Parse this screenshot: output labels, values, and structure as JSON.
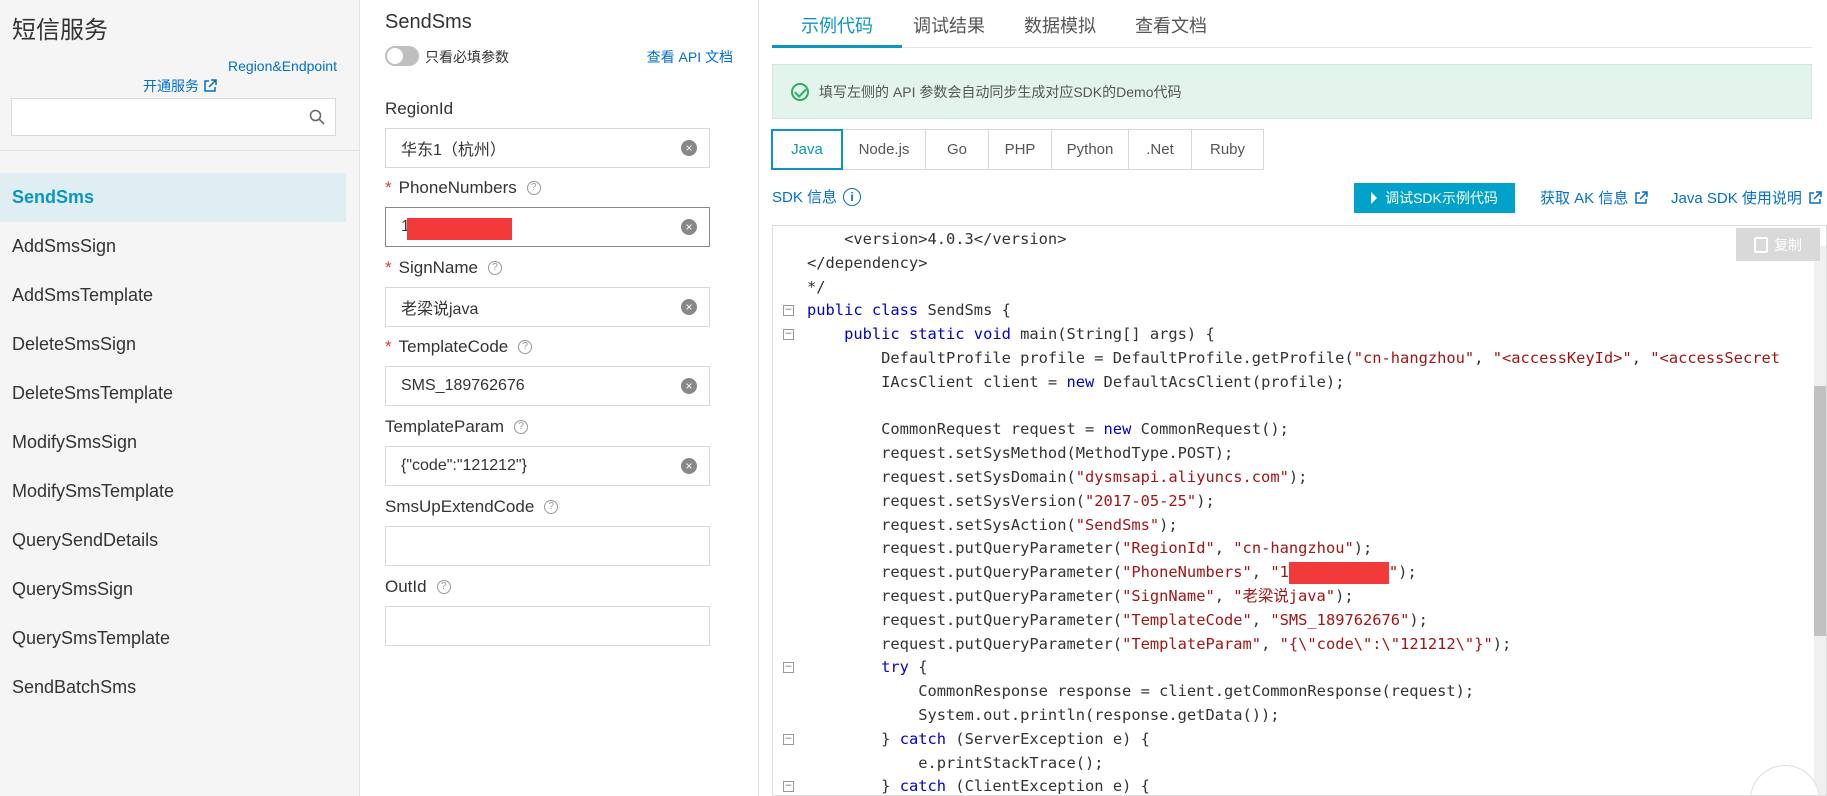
{
  "sidebar": {
    "title": "短信服务",
    "region_link": "Region&Endpoint",
    "open_service": "开通服务",
    "search_placeholder": "",
    "items": [
      "SendSms",
      "AddSmsSign",
      "AddSmsTemplate",
      "DeleteSmsSign",
      "DeleteSmsTemplate",
      "ModifySmsSign",
      "ModifySmsTemplate",
      "QuerySendDetails",
      "QuerySmsSign",
      "QuerySmsTemplate",
      "SendBatchSms"
    ],
    "active_item": "SendSms"
  },
  "params": {
    "title": "SendSms",
    "required_toggle_label": "只看必填参数",
    "api_doc_link": "查看 API 文档",
    "fields": [
      {
        "label": "RegionId",
        "required": false,
        "value": "华东1（杭州）"
      },
      {
        "label": "PhoneNumbers",
        "required": true,
        "value": "1"
      },
      {
        "label": "SignName",
        "required": true,
        "value": "老梁说java"
      },
      {
        "label": "TemplateCode",
        "required": true,
        "value": "SMS_189762676"
      },
      {
        "label": "TemplateParam",
        "required": false,
        "value": "{\"code\":\"121212\"}"
      },
      {
        "label": "SmsUpExtendCode",
        "required": false,
        "value": ""
      },
      {
        "label": "OutId",
        "required": false,
        "value": ""
      }
    ]
  },
  "code_panel": {
    "tabs": [
      "示例代码",
      "调试结果",
      "数据模拟",
      "查看文档"
    ],
    "active_tab": "示例代码",
    "notice": "填写左侧的 API 参数会自动同步生成对应SDK的Demo代码",
    "languages": [
      "Java",
      "Node.js",
      "Go",
      "PHP",
      "Python",
      ".Net",
      "Ruby"
    ],
    "active_language": "Java",
    "sdk_info": "SDK 信息",
    "debug_button": "调试SDK示例代码",
    "ak_link": "获取 AK 信息",
    "java_sdk_link": "Java SDK 使用说明",
    "copy_button": "复制",
    "code_lines": [
      {
        "indent": 1,
        "fold": false,
        "parts": [
          [
            "t",
            "<version>4.0.3</version>"
          ]
        ]
      },
      {
        "indent": 0,
        "fold": false,
        "parts": [
          [
            "t",
            "</dependency>"
          ]
        ]
      },
      {
        "indent": 0,
        "fold": false,
        "parts": [
          [
            "t",
            "*/"
          ]
        ]
      },
      {
        "indent": 0,
        "fold": true,
        "parts": [
          [
            "k",
            "public class"
          ],
          [
            "t",
            " SendSms {"
          ]
        ]
      },
      {
        "indent": 1,
        "fold": true,
        "parts": [
          [
            "k",
            "public static void"
          ],
          [
            "t",
            " main(String[] args) {"
          ]
        ]
      },
      {
        "indent": 2,
        "fold": false,
        "parts": [
          [
            "t",
            "DefaultProfile profile = DefaultProfile.getProfile("
          ],
          [
            "s",
            "\"cn-hangzhou\""
          ],
          [
            "t",
            ", "
          ],
          [
            "s",
            "\"<accessKeyId>\""
          ],
          [
            "t",
            ", "
          ],
          [
            "s",
            "\"<accessSecret"
          ]
        ]
      },
      {
        "indent": 2,
        "fold": false,
        "parts": [
          [
            "t",
            "IAcsClient client = "
          ],
          [
            "k",
            "new"
          ],
          [
            "t",
            " DefaultAcsClient(profile);"
          ]
        ]
      },
      {
        "indent": 0,
        "fold": false,
        "parts": []
      },
      {
        "indent": 2,
        "fold": false,
        "parts": [
          [
            "t",
            "CommonRequest request = "
          ],
          [
            "k",
            "new"
          ],
          [
            "t",
            " CommonRequest();"
          ]
        ]
      },
      {
        "indent": 2,
        "fold": false,
        "parts": [
          [
            "t",
            "request.setSysMethod(MethodType.POST);"
          ]
        ]
      },
      {
        "indent": 2,
        "fold": false,
        "parts": [
          [
            "t",
            "request.setSysDomain("
          ],
          [
            "s",
            "\"dysmsapi.aliyuncs.com\""
          ],
          [
            "t",
            ");"
          ]
        ]
      },
      {
        "indent": 2,
        "fold": false,
        "parts": [
          [
            "t",
            "request.setSysVersion("
          ],
          [
            "s",
            "\"2017-05-25\""
          ],
          [
            "t",
            ");"
          ]
        ]
      },
      {
        "indent": 2,
        "fold": false,
        "parts": [
          [
            "t",
            "request.setSysAction("
          ],
          [
            "s",
            "\"SendSms\""
          ],
          [
            "t",
            ");"
          ]
        ]
      },
      {
        "indent": 2,
        "fold": false,
        "parts": [
          [
            "t",
            "request.putQueryParameter("
          ],
          [
            "s",
            "\"RegionId\""
          ],
          [
            "t",
            ", "
          ],
          [
            "s",
            "\"cn-hangzhou\""
          ],
          [
            "t",
            ");"
          ]
        ]
      },
      {
        "indent": 2,
        "fold": false,
        "parts": [
          [
            "t",
            "request.putQueryParameter("
          ],
          [
            "s",
            "\"PhoneNumbers\""
          ],
          [
            "t",
            ", "
          ],
          [
            "s",
            "\"1"
          ],
          [
            "r",
            ""
          ],
          [
            "s",
            "\""
          ],
          [
            "t",
            ");"
          ]
        ]
      },
      {
        "indent": 2,
        "fold": false,
        "parts": [
          [
            "t",
            "request.putQueryParameter("
          ],
          [
            "s",
            "\"SignName\""
          ],
          [
            "t",
            ", "
          ],
          [
            "s",
            "\"老梁说java\""
          ],
          [
            "t",
            ");"
          ]
        ]
      },
      {
        "indent": 2,
        "fold": false,
        "parts": [
          [
            "t",
            "request.putQueryParameter("
          ],
          [
            "s",
            "\"TemplateCode\""
          ],
          [
            "t",
            ", "
          ],
          [
            "s",
            "\"SMS_189762676\""
          ],
          [
            "t",
            ");"
          ]
        ]
      },
      {
        "indent": 2,
        "fold": false,
        "parts": [
          [
            "t",
            "request.putQueryParameter("
          ],
          [
            "s",
            "\"TemplateParam\""
          ],
          [
            "t",
            ", "
          ],
          [
            "s",
            "\"{\\\"code\\\":\\\"121212\\\"}\""
          ],
          [
            "t",
            ");"
          ]
        ]
      },
      {
        "indent": 2,
        "fold": true,
        "parts": [
          [
            "k",
            "try"
          ],
          [
            "t",
            " {"
          ]
        ]
      },
      {
        "indent": 3,
        "fold": false,
        "parts": [
          [
            "t",
            "CommonResponse response = client.getCommonResponse(request);"
          ]
        ]
      },
      {
        "indent": 3,
        "fold": false,
        "parts": [
          [
            "t",
            "System.out.println(response.getData());"
          ]
        ]
      },
      {
        "indent": 2,
        "fold": true,
        "parts": [
          [
            "t",
            "} "
          ],
          [
            "k",
            "catch"
          ],
          [
            "t",
            " (ServerException e) {"
          ]
        ]
      },
      {
        "indent": 3,
        "fold": false,
        "parts": [
          [
            "t",
            "e.printStackTrace();"
          ]
        ]
      },
      {
        "indent": 2,
        "fold": true,
        "parts": [
          [
            "t",
            "} "
          ],
          [
            "k",
            "catch"
          ],
          [
            "t",
            " (ClientException e) {"
          ]
        ]
      }
    ]
  }
}
